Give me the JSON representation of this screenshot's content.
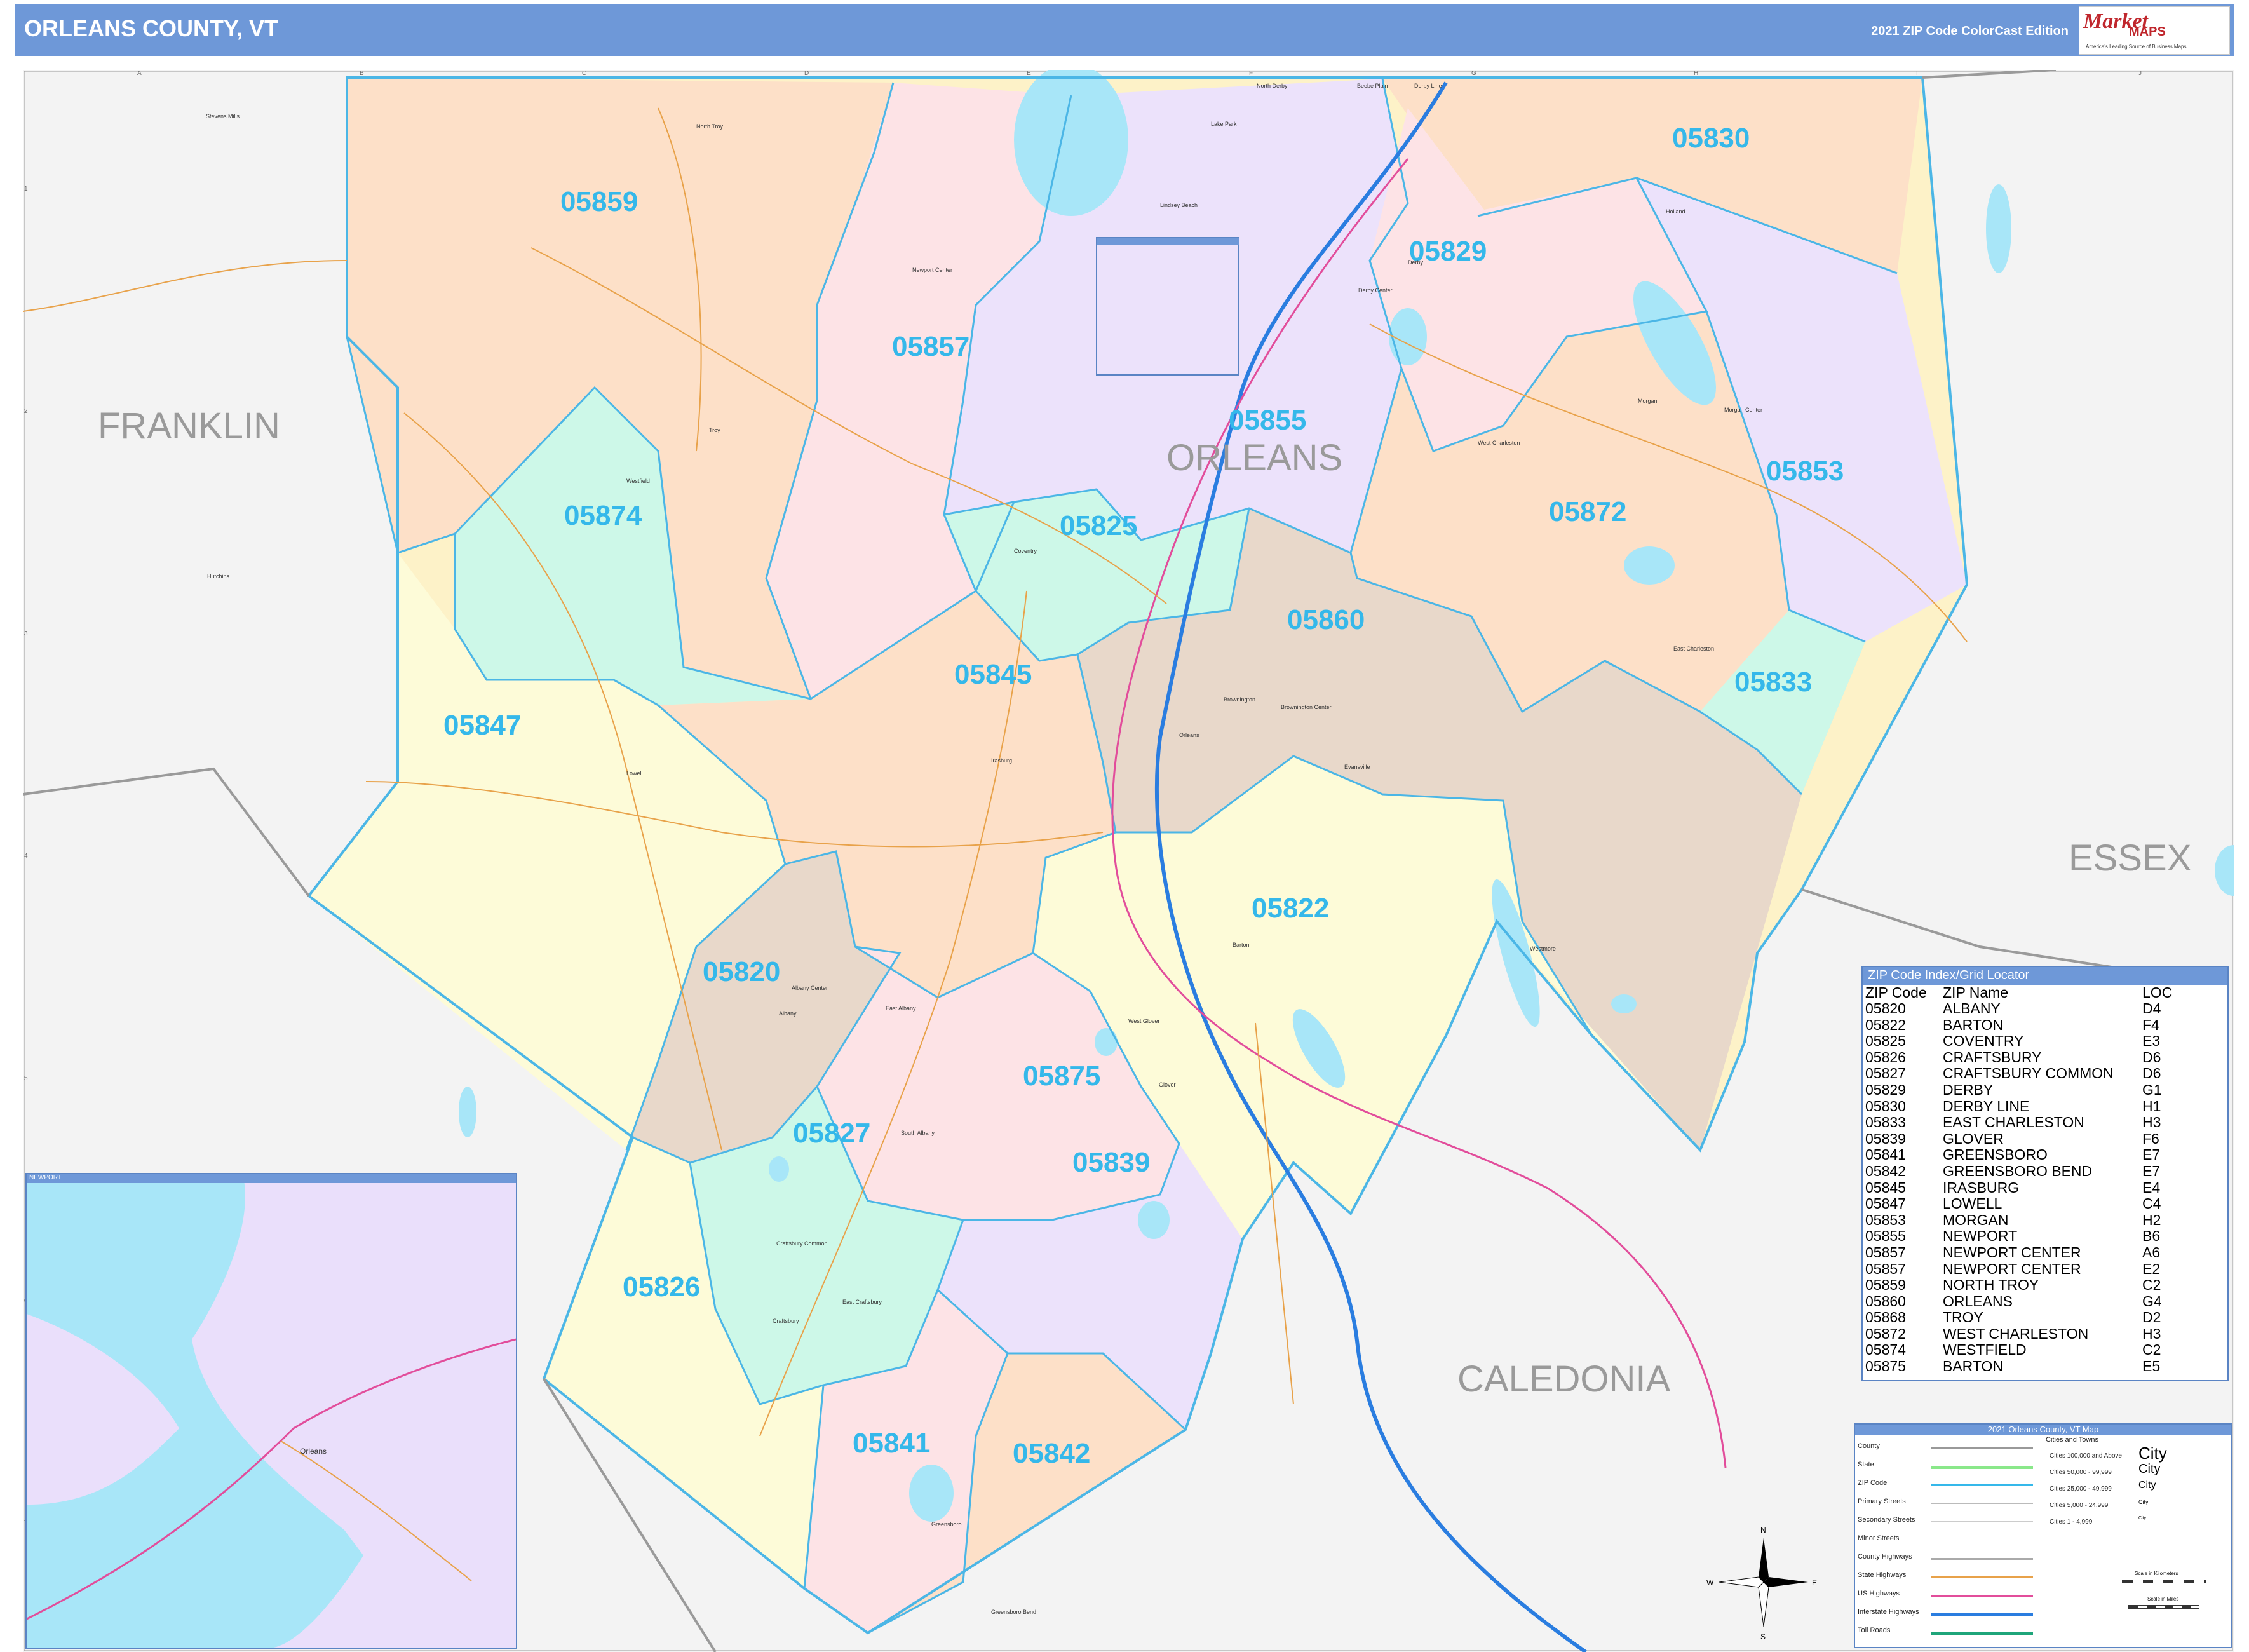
{
  "header": {
    "title": "ORLEANS COUNTY, VT",
    "edition": "2021 ZIP Code ColorCast Edition",
    "logo_word": "Market",
    "logo_word2": "MAPS",
    "logo_tagline": "America's Leading Source of Business Maps"
  },
  "colors": {
    "header_bg": "#6e98d8",
    "zip_label": "#35b8ea",
    "zip_boundary": "#4bb6e6",
    "water": "#a8e6f8",
    "outside": "#f2f2f2"
  },
  "map": {
    "county_labels": [
      "FRANKLIN",
      "ORLEANS",
      "ESSEX",
      "CALEDONIA"
    ],
    "inset_title": "NEWPORT",
    "grid_columns": [
      "A",
      "B",
      "C",
      "D",
      "E",
      "F",
      "G",
      "H",
      "I",
      "J"
    ],
    "grid_rows": [
      "1",
      "2",
      "3",
      "4",
      "5",
      "6",
      "7"
    ],
    "zip_labels": [
      "05859",
      "05857",
      "05855",
      "05830",
      "05829",
      "05853",
      "05872",
      "05874",
      "05825",
      "05860",
      "05845",
      "05833",
      "05847",
      "05822",
      "05820",
      "05875",
      "05827",
      "05839",
      "05826",
      "05841",
      "05842"
    ],
    "towns": [
      "North Troy",
      "Newport Center",
      "Lake Park",
      "Lindsey Beach",
      "Derby Center",
      "Derby",
      "Holland",
      "Morgan",
      "Morgan Center",
      "West Charleston",
      "Coventry",
      "Irasburg",
      "Lowell",
      "Westfield",
      "Troy",
      "Hutchins",
      "Brownington",
      "Brownington Center",
      "East Charleston",
      "Orleans",
      "Evansville",
      "Westmore",
      "Albany Center",
      "Albany",
      "East Albany",
      "West Glover",
      "Glover",
      "South Albany",
      "Craftsbury Common",
      "East Craftsbury",
      "Craftsbury",
      "Barton",
      "Greensboro",
      "Greensboro Bend",
      "Stevens Mills",
      "Beebe Plain",
      "Derby Line",
      "North Derby"
    ]
  },
  "index": {
    "title": "ZIP Code Index/Grid Locator",
    "headers": [
      "ZIP Code",
      "ZIP Name",
      "LOC"
    ],
    "rows": [
      [
        "05820",
        "ALBANY",
        "D4"
      ],
      [
        "05822",
        "BARTON",
        "F4"
      ],
      [
        "05825",
        "COVENTRY",
        "E3"
      ],
      [
        "05826",
        "CRAFTSBURY",
        "D6"
      ],
      [
        "05827",
        "CRAFTSBURY COMMON",
        "D6"
      ],
      [
        "05829",
        "DERBY",
        "G1"
      ],
      [
        "05830",
        "DERBY LINE",
        "H1"
      ],
      [
        "05833",
        "EAST CHARLESTON",
        "H3"
      ],
      [
        "05839",
        "GLOVER",
        "F6"
      ],
      [
        "05841",
        "GREENSBORO",
        "E7"
      ],
      [
        "05842",
        "GREENSBORO BEND",
        "E7"
      ],
      [
        "05845",
        "IRASBURG",
        "E4"
      ],
      [
        "05847",
        "LOWELL",
        "C4"
      ],
      [
        "05853",
        "MORGAN",
        "H2"
      ],
      [
        "05855",
        "NEWPORT",
        "B6"
      ],
      [
        "05857",
        "NEWPORT CENTER",
        "A6"
      ],
      [
        "05857",
        "NEWPORT CENTER",
        "E2"
      ],
      [
        "05859",
        "NORTH TROY",
        "C2"
      ],
      [
        "05860",
        "ORLEANS",
        "G4"
      ],
      [
        "05868",
        "TROY",
        "D2"
      ],
      [
        "05872",
        "WEST CHARLESTON",
        "H3"
      ],
      [
        "05874",
        "WESTFIELD",
        "C2"
      ],
      [
        "05875",
        "BARTON",
        "E5"
      ]
    ]
  },
  "legend": {
    "title": "2021 Orleans County, VT Map",
    "items": [
      "County",
      "State",
      "ZIP Code",
      "Primary Streets",
      "Secondary Streets",
      "Minor Streets",
      "County Highways",
      "State Highways",
      "US Highways",
      "Interstate Highways",
      "Toll Roads"
    ],
    "cities_title": "Cities and Towns",
    "city_classes": [
      "Cities 100,000 and Above",
      "Cities 50,000 - 99,999",
      "Cities 25,000 - 49,999",
      "Cities 5,000 - 24,999",
      "Cities 1 - 4,999"
    ],
    "city_samples": [
      "City",
      "City",
      "City",
      "City",
      "City"
    ],
    "scale_km": "Scale in Kilometers",
    "scale_mi": "Scale in Miles",
    "compass": [
      "N",
      "S",
      "E",
      "W"
    ]
  }
}
